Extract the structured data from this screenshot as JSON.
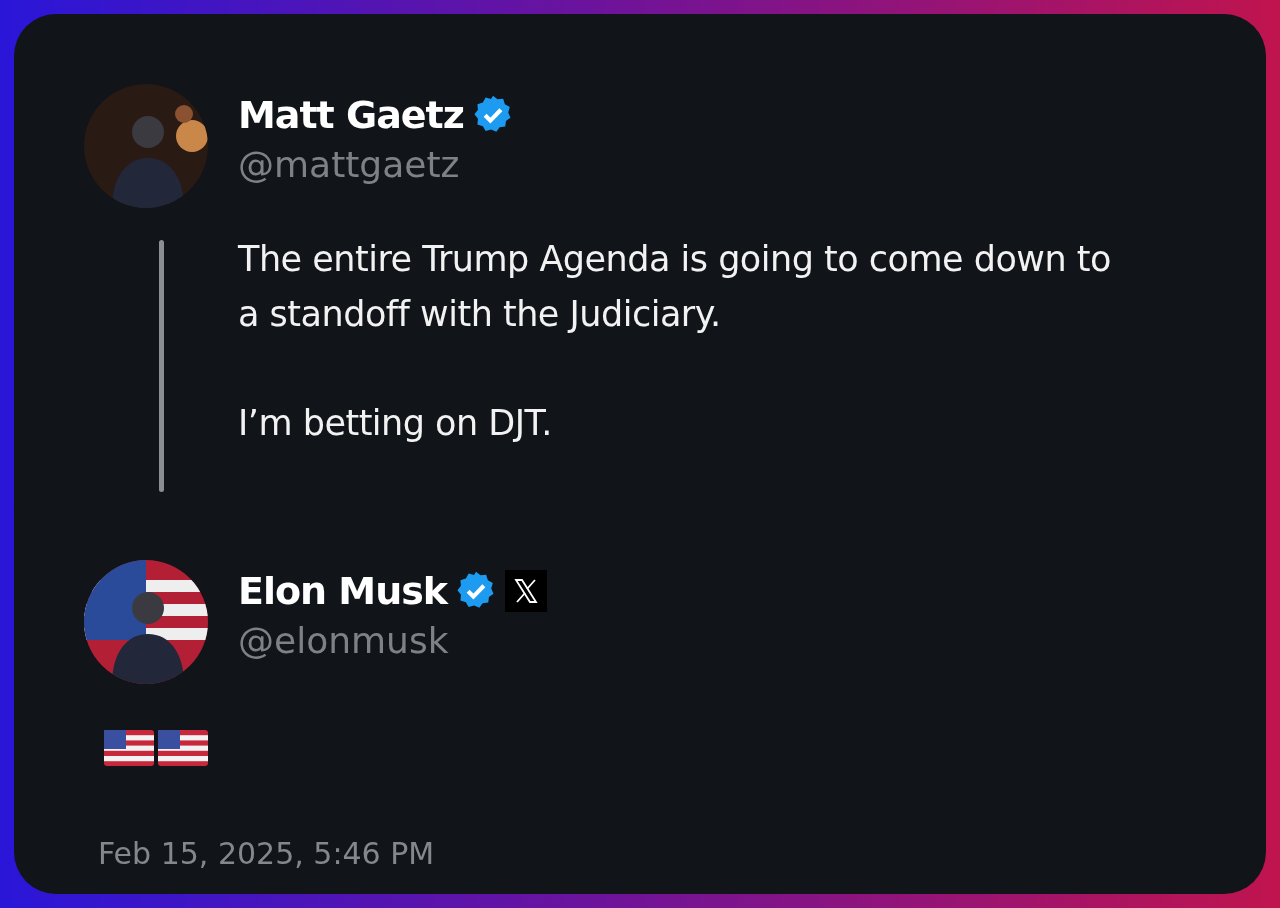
{
  "tweets": [
    {
      "kind": "quoted",
      "name": "Matt Gaetz",
      "verified": true,
      "handle": "@mattgaetz",
      "thread_line": true,
      "paragraphs": [
        "The entire Trump Agenda is going to come down to a standoff with the Judiciary.",
        "I’m betting on DJT."
      ]
    },
    {
      "kind": "reply",
      "name": "Elon Musk",
      "verified": true,
      "affiliate_logo": true,
      "handle": "@elonmusk",
      "timestamp": "Feb 15, 2025, 5:46 PM"
    }
  ]
}
